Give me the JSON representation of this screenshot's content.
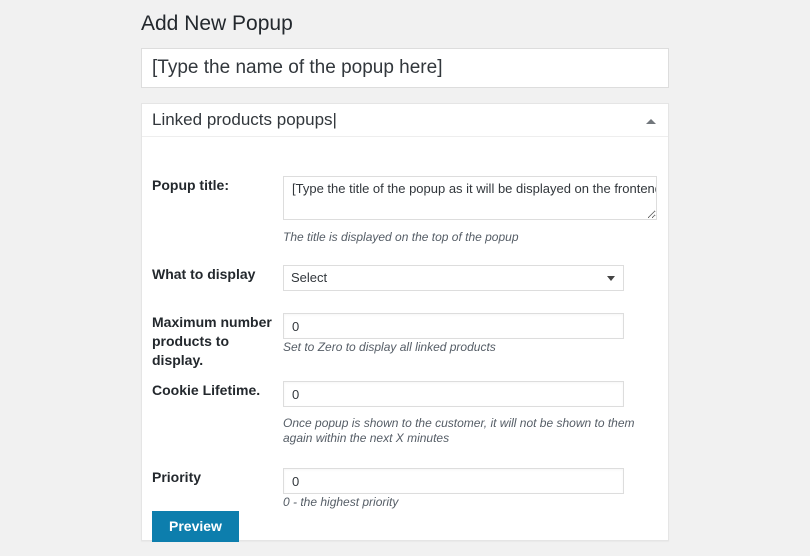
{
  "page": {
    "title": "Add New Popup"
  },
  "post_title": {
    "value": "",
    "placeholder": "[Type the name of the popup here]"
  },
  "metabox": {
    "heading": "Linked products popups",
    "caret": "|",
    "toggle_icon": "triangle-up-icon",
    "fields": [
      {
        "label": "Popup title:",
        "control": "textarea",
        "value": "[Type the title of the popup as it will be displayed on the frontend.)",
        "help": "The title is displayed on the top of the popup"
      },
      {
        "label": "What to display",
        "control": "select",
        "value": "Select",
        "options": [
          "Select"
        ],
        "help": ""
      },
      {
        "label": "Maximum number products to display.",
        "control": "text",
        "value": "0",
        "help": "Set to Zero to display all linked products"
      },
      {
        "label": "Cookie Lifetime.",
        "control": "text",
        "value": "0",
        "help": "Once popup is shown to the customer, it will not be shown to them again within the next X minutes"
      },
      {
        "label": "Priority",
        "control": "text",
        "value": "0",
        "help": "0 - the highest priority"
      }
    ],
    "preview_button": "Preview"
  },
  "colors": {
    "accent": "#0d7ead",
    "page_background": "#f1f1f1",
    "panel_background": "#ffffff",
    "border": "#e5e5e5",
    "help_text": "#555d66"
  }
}
